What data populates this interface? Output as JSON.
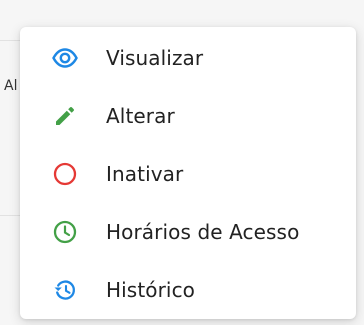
{
  "menu": {
    "items": [
      {
        "label": "Visualizar",
        "icon": "eye-icon",
        "color": "#1e88e5"
      },
      {
        "label": "Alterar",
        "icon": "pencil-icon",
        "color": "#43a047"
      },
      {
        "label": "Inativar",
        "icon": "circle-icon",
        "color": "#e53935"
      },
      {
        "label": "Horários de Acesso",
        "icon": "clock-icon",
        "color": "#43a047"
      },
      {
        "label": "Histórico",
        "icon": "history-icon",
        "color": "#1e88e5"
      }
    ]
  },
  "background": {
    "partial_text": "Al"
  }
}
